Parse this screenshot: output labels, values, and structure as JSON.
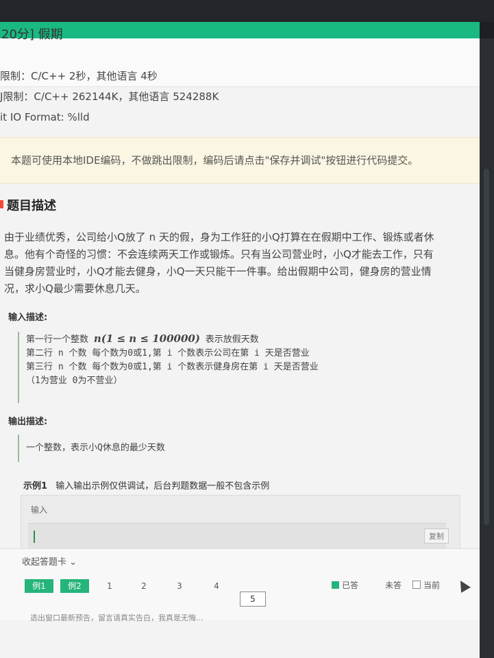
{
  "header": {
    "title": "20分] 假期"
  },
  "limits": {
    "time": "限制：C/C++ 2秒，其他语言 4秒",
    "memory": "J限制：C/C++ 262144K，其他语言 524288K",
    "io": "it IO Format: %lld"
  },
  "notice": {
    "text": "本题可使用本地IDE编码，不做跳出限制，编码后请点击\"保存并调试\"按钮进行代码提交。"
  },
  "problem": {
    "section_title": "题目描述",
    "lines": [
      "由于业绩优秀，公司给小Q放了 n 天的假，身为工作狂的小Q打算在在假期中工作、锻炼或者休",
      "息。他有个奇怪的习惯：不会连续两天工作或锻炼。只有当公司营业时，小Q才能去工作，只有",
      "当健身房营业时，小Q才能去健身，小Q一天只能干一件事。给出假期中公司，健身房的营业情",
      "况，求小Q最少需要休息几天。"
    ]
  },
  "input_desc": {
    "title": "输入描述:",
    "line1_prefix": "第一行一个整数",
    "line1_math": "n(1 ≤ n ≤ 100000)",
    "line1_suffix": "表示放假天数",
    "line2": "第二行 n 个数 每个数为0或1,第 i 个数表示公司在第 i 天是否营业",
    "line3": "第三行 n 个数 每个数为0或1,第 i 个数表示健身房在第 i 天是否营业",
    "line4": "（1为营业 0为不营业）"
  },
  "output_desc": {
    "title": "输出描述:",
    "text": "一个整数，表示小Q休息的最少天数"
  },
  "example": {
    "title": "示例1",
    "note": "输入输出示例仅供调试，后台判题数据一般不包含示例",
    "input_label": "输入",
    "copy_label": "复制"
  },
  "answer_card": {
    "toggle_label": "收起答题卡 ⌄",
    "buttons": [
      "例1",
      "例2",
      "1",
      "2",
      "3",
      "4",
      "5"
    ],
    "legend_done": "已答",
    "legend_todo": "未答",
    "legend_current": "当前",
    "footer": "选出窗口最新预告，留言请真实告白，我真是无悔..."
  },
  "colors": {
    "accent_green": "#19b981",
    "done_green": "#25b47a",
    "marker_red": "#f04b3a"
  }
}
